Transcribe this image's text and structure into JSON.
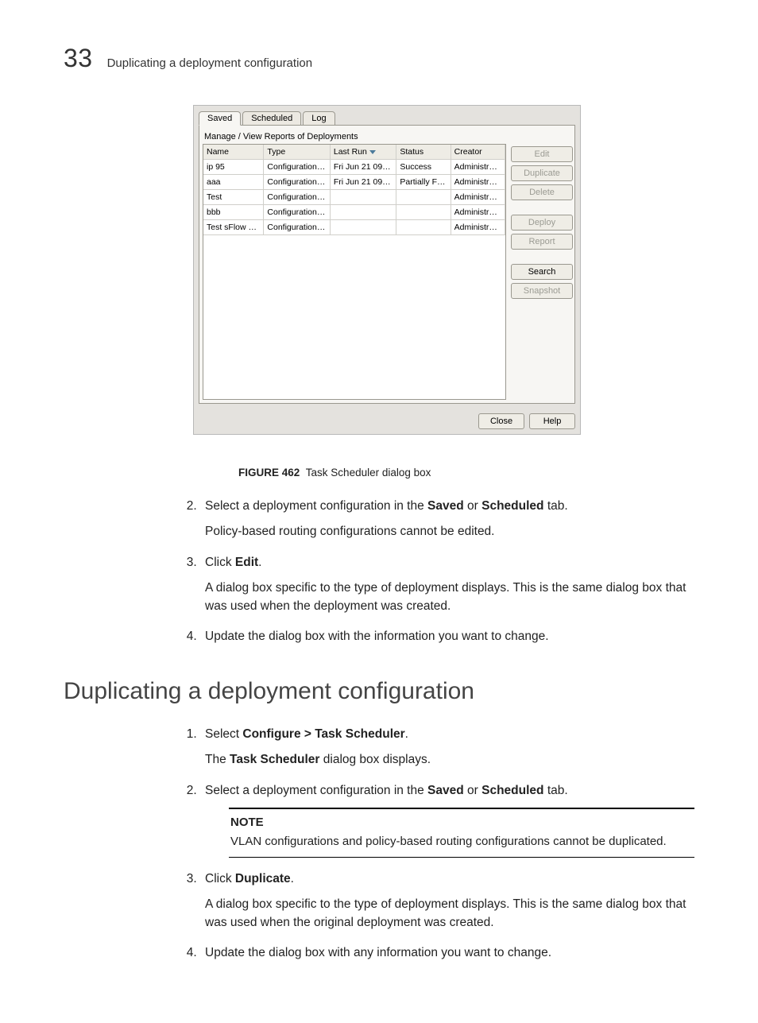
{
  "header": {
    "chapter_number": "33",
    "chapter_title": "Duplicating a deployment configuration"
  },
  "dialog": {
    "tabs": [
      "Saved",
      "Scheduled",
      "Log"
    ],
    "active_tab": 0,
    "subtitle": "Manage / View Reports of Deployments",
    "columns": [
      "Name",
      "Type",
      "Last Run",
      "Status",
      "Creator"
    ],
    "sort_col": 2,
    "rows": [
      {
        "name": "ip 95",
        "type": "Configuration …",
        "last_run": "Fri Jun 21 09:…",
        "status": "Success",
        "creator": "Administrator"
      },
      {
        "name": "aaa",
        "type": "Configuration …",
        "last_run": "Fri Jun 21 09:…",
        "status": "Partially Failed",
        "creator": "Administrator"
      },
      {
        "name": "Test",
        "type": "Configuration …",
        "last_run": "",
        "status": "",
        "creator": "Administrator"
      },
      {
        "name": "bbb",
        "type": "Configuration …",
        "last_run": "",
        "status": "",
        "creator": "Administrator"
      },
      {
        "name": "Test sFlow C…",
        "type": "Configuration …",
        "last_run": "",
        "status": "",
        "creator": "Administrator"
      }
    ],
    "buttons": {
      "edit": "Edit",
      "duplicate": "Duplicate",
      "delete": "Delete",
      "deploy": "Deploy",
      "report": "Report",
      "search": "Search",
      "snapshot": "Snapshot"
    },
    "footer": {
      "close": "Close",
      "help": "Help"
    }
  },
  "figure": {
    "label": "FIGURE 462",
    "caption": "Task Scheduler dialog box"
  },
  "steps_a": {
    "s2_a": "Select a deployment configuration in the ",
    "s2_b": "Saved",
    "s2_c": " or ",
    "s2_d": "Scheduled",
    "s2_e": " tab.",
    "s2_sub": "Policy-based routing configurations cannot be edited.",
    "s3_a": "Click ",
    "s3_b": "Edit",
    "s3_c": ".",
    "s3_sub": "A dialog box specific to the type of deployment displays. This is the same dialog box that was used when the deployment was created.",
    "s4": "Update the dialog box with the information you want to change."
  },
  "section_title": "Duplicating a deployment configuration",
  "steps_b": {
    "s1_a": "Select ",
    "s1_b": "Configure > Task Scheduler",
    "s1_c": ".",
    "s1_sub_a": "The ",
    "s1_sub_b": "Task Scheduler",
    "s1_sub_c": " dialog box displays.",
    "s2_a": "Select a deployment configuration in the ",
    "s2_b": "Saved",
    "s2_c": " or ",
    "s2_d": "Scheduled",
    "s2_e": " tab.",
    "note_label": "NOTE",
    "note_text": "VLAN configurations and policy-based routing configurations cannot be duplicated.",
    "s3_a": "Click ",
    "s3_b": "Duplicate",
    "s3_c": ".",
    "s3_sub": "A dialog box specific to the type of deployment displays. This is the same dialog box that was used when the original deployment was created.",
    "s4": "Update the dialog box with any information you want to change."
  }
}
